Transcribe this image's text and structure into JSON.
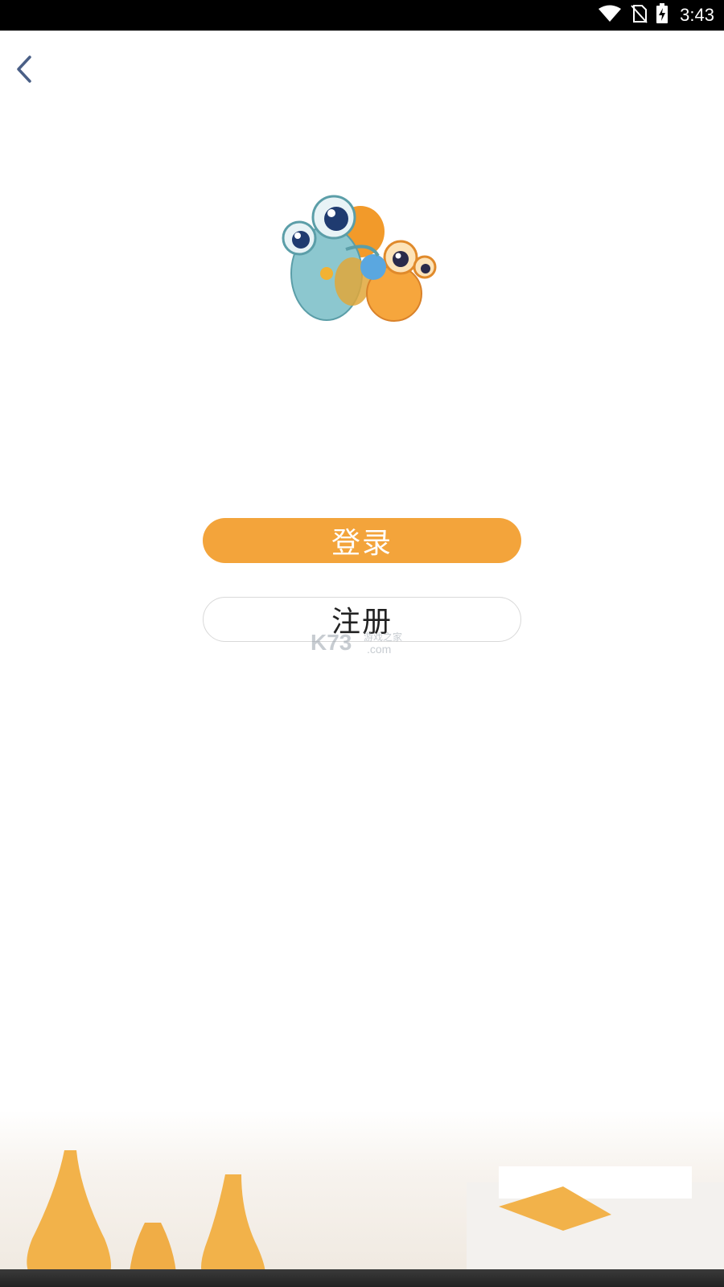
{
  "status_bar": {
    "time": "3:43",
    "icons": [
      "wifi-icon",
      "no-sim-icon",
      "battery-charging-icon"
    ]
  },
  "nav": {
    "back_icon": "chevron-left-icon"
  },
  "logo": {
    "icon": "mascot-logo"
  },
  "buttons": {
    "login_label": "登录",
    "register_label": "注册"
  },
  "watermark": {
    "brand": "K73",
    "tagline": "游戏之家",
    "domain": ".com"
  },
  "colors": {
    "accent": "#f3a43b",
    "back_icon": "#4a5f86",
    "register_border": "#d9d9d9"
  }
}
